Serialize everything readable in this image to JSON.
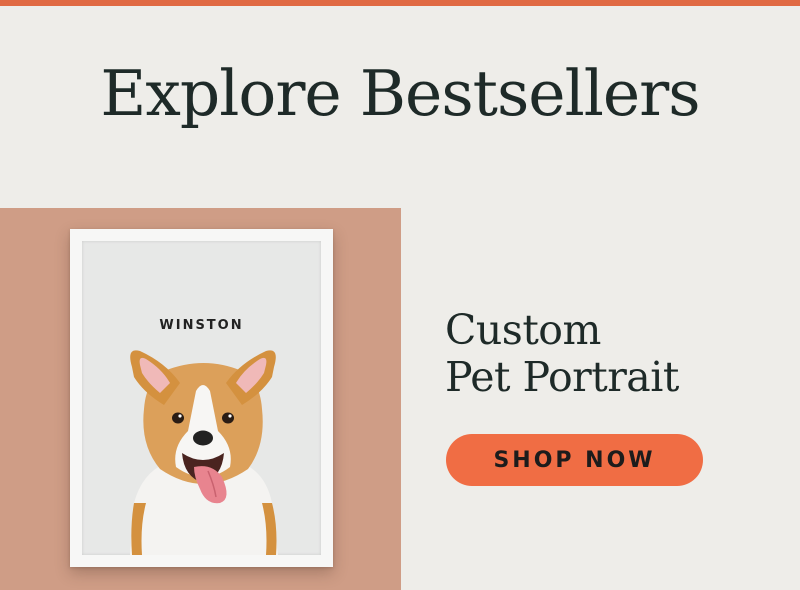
{
  "page": {
    "headline": "Explore Bestsellers"
  },
  "product": {
    "title_line1": "Custom",
    "title_line2": "Pet Portrait",
    "portrait_name": "WINSTON",
    "cta_label": "SHOP NOW",
    "image_subject": "corgi-portrait-illustration"
  },
  "colors": {
    "background": "#eeede9",
    "accent": "#f06d44",
    "panel": "#cf9d86",
    "text": "#1e2a28"
  }
}
